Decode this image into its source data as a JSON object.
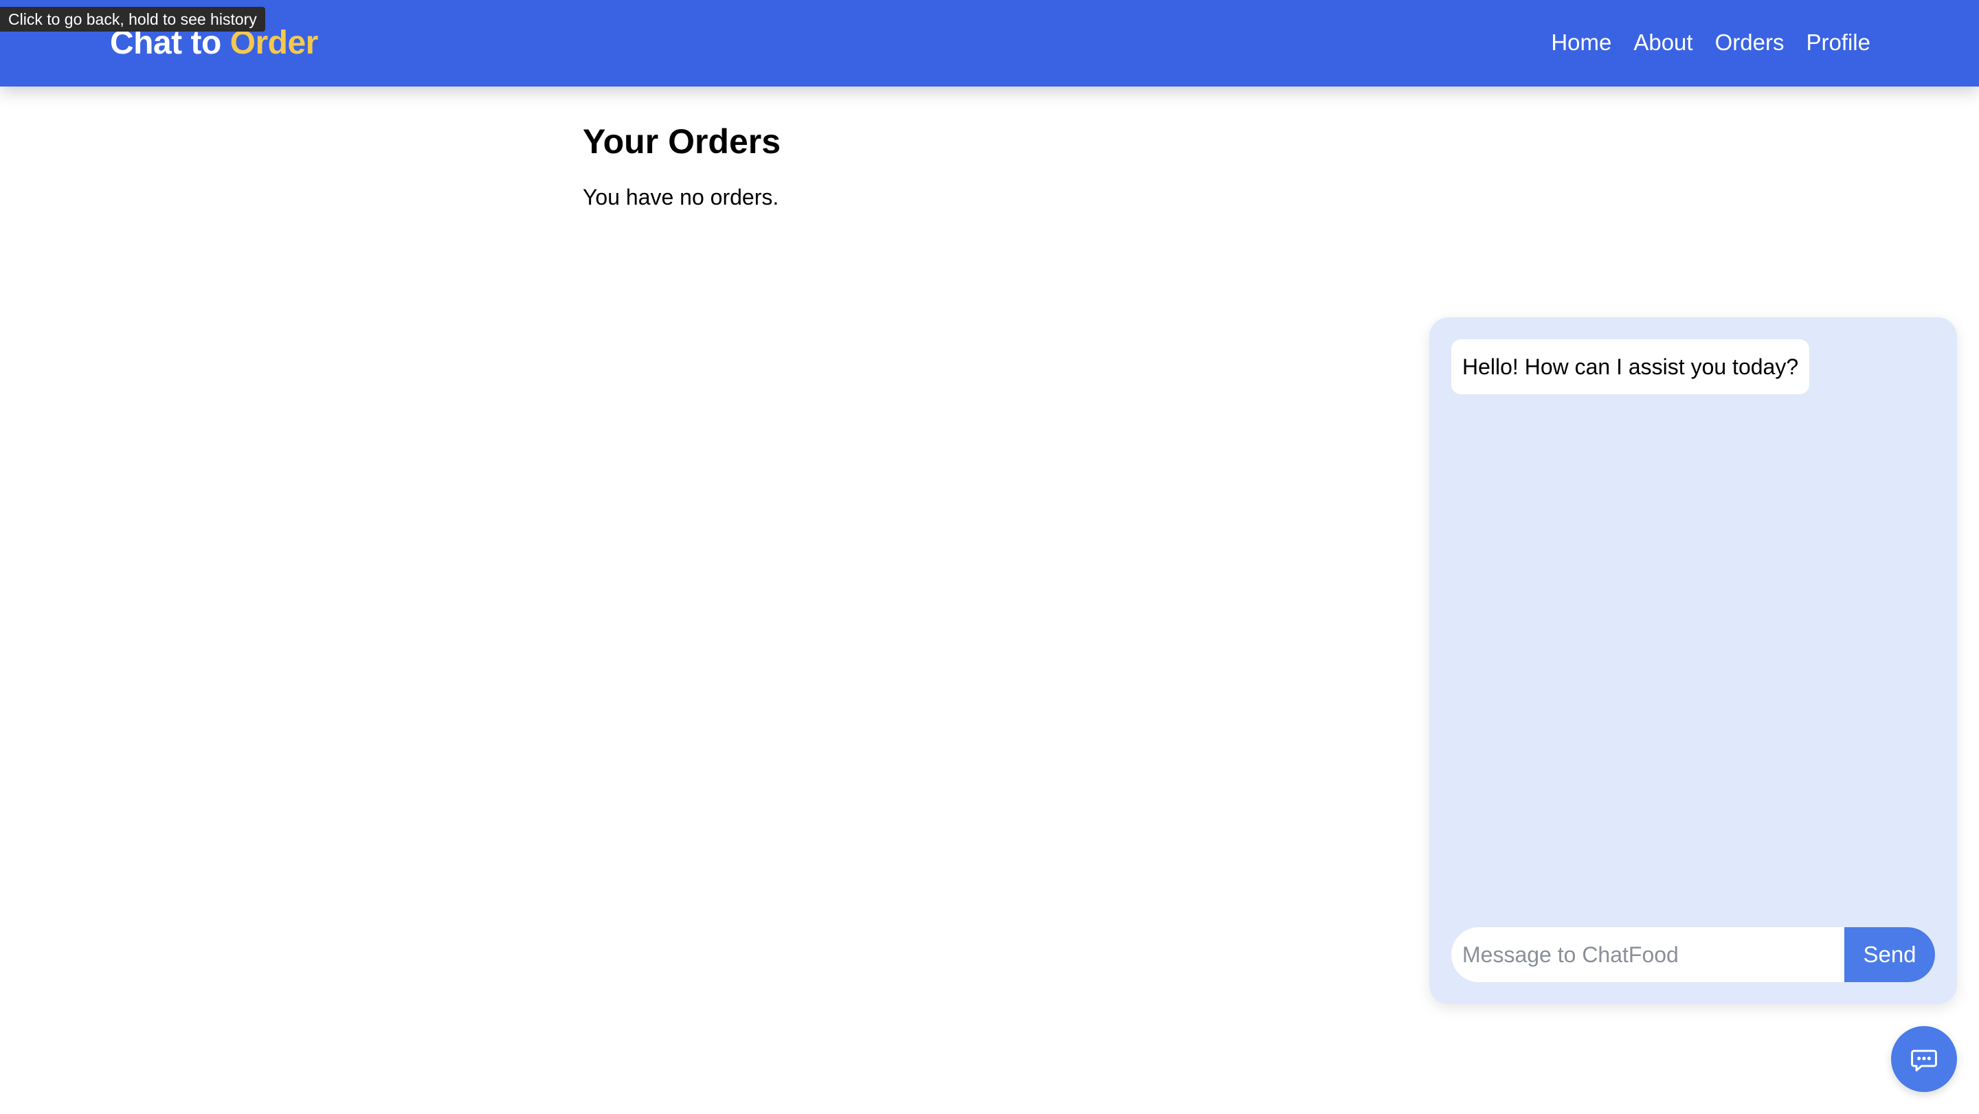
{
  "tooltip": {
    "text": "Click to go back, hold to see history"
  },
  "brand": {
    "part1": "Chat to ",
    "part2": "Order"
  },
  "nav": {
    "items": [
      {
        "label": "Home"
      },
      {
        "label": "About"
      },
      {
        "label": "Orders"
      },
      {
        "label": "Profile"
      }
    ]
  },
  "main": {
    "title": "Your Orders",
    "empty_message": "You have no orders."
  },
  "chat": {
    "greeting": "Hello! How can I assist you today?",
    "input_placeholder": "Message to ChatFood",
    "input_value": "",
    "send_label": "Send",
    "fab_icon": "chat-bubble-icon"
  },
  "colors": {
    "navbar": "#3a63e3",
    "brand_accent": "#f4c94d",
    "chat_panel": "#dfe9fb",
    "primary_button": "#4a7be8"
  }
}
